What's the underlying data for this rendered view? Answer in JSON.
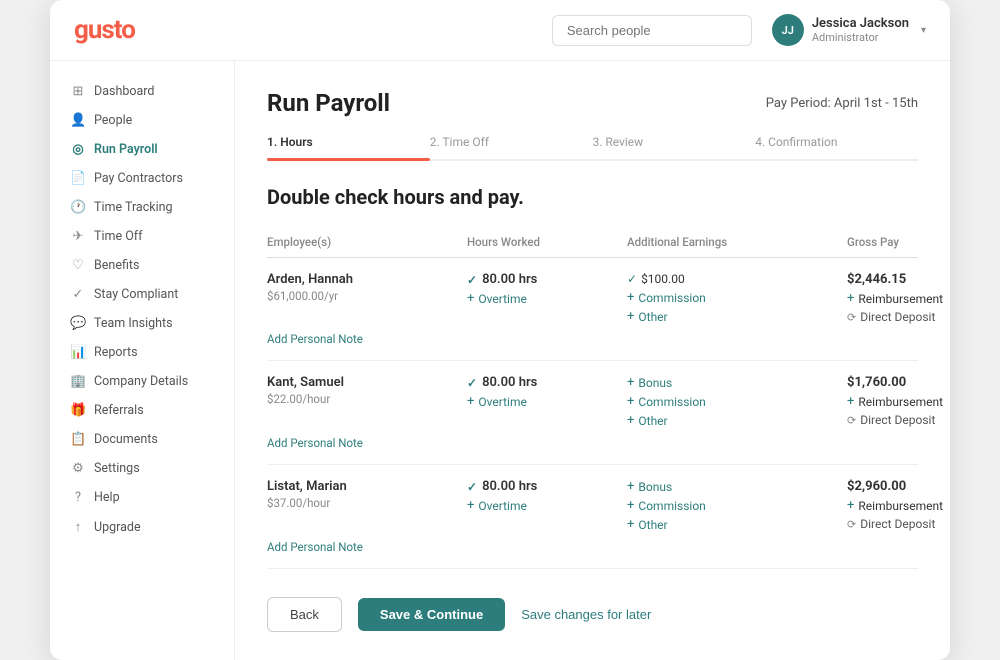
{
  "logo": "gusto",
  "search": {
    "placeholder": "Search people"
  },
  "user": {
    "name": "Jessica Jackson",
    "role": "Administrator",
    "initials": "JJ"
  },
  "sidebar": {
    "items": [
      {
        "id": "dashboard",
        "label": "Dashboard",
        "icon": "⊞",
        "active": false
      },
      {
        "id": "people",
        "label": "People",
        "icon": "👤",
        "active": false
      },
      {
        "id": "run-payroll",
        "label": "Run Payroll",
        "icon": "◎",
        "active": true
      },
      {
        "id": "pay-contractors",
        "label": "Pay Contractors",
        "icon": "📄",
        "active": false
      },
      {
        "id": "time-tracking",
        "label": "Time Tracking",
        "icon": "🕐",
        "active": false
      },
      {
        "id": "time-off",
        "label": "Time Off",
        "icon": "✈",
        "active": false
      },
      {
        "id": "benefits",
        "label": "Benefits",
        "icon": "♡",
        "active": false
      },
      {
        "id": "stay-compliant",
        "label": "Stay Compliant",
        "icon": "✓",
        "active": false
      },
      {
        "id": "team-insights",
        "label": "Team Insights",
        "icon": "💬",
        "active": false
      },
      {
        "id": "reports",
        "label": "Reports",
        "icon": "📊",
        "active": false
      },
      {
        "id": "company-details",
        "label": "Company Details",
        "icon": "🏢",
        "active": false
      },
      {
        "id": "referrals",
        "label": "Referrals",
        "icon": "🎁",
        "active": false
      },
      {
        "id": "documents",
        "label": "Documents",
        "icon": "📋",
        "active": false
      },
      {
        "id": "settings",
        "label": "Settings",
        "icon": "⚙",
        "active": false
      },
      {
        "id": "help",
        "label": "Help",
        "icon": "?",
        "active": false
      },
      {
        "id": "upgrade",
        "label": "Upgrade",
        "icon": "↑",
        "active": false
      }
    ]
  },
  "page": {
    "title": "Run Payroll",
    "pay_period": "Pay Period: April 1st - 15th",
    "steps": [
      {
        "label": "1. Hours",
        "active": true
      },
      {
        "label": "2. Time Off",
        "active": false
      },
      {
        "label": "3. Review",
        "active": false
      },
      {
        "label": "4. Confirmation",
        "active": false
      }
    ],
    "section_heading": "Double check hours and pay.",
    "table_headers": {
      "employee": "Employee(s)",
      "hours": "Hours Worked",
      "earnings": "Additional Earnings",
      "gross": "Gross Pay"
    },
    "employees": [
      {
        "name": "Arden, Hannah",
        "rate": "$61,000.00/yr",
        "hours": "80.00 hrs",
        "overtime_label": "Overtime",
        "earnings": [
          {
            "type": "value",
            "label": "$100.00"
          },
          {
            "type": "add",
            "label": "Commission"
          },
          {
            "type": "add",
            "label": "Other"
          }
        ],
        "gross": "$2,446.15",
        "gross_actions": [
          {
            "type": "add",
            "label": "Reimbursement"
          },
          {
            "type": "dd",
            "label": "Direct Deposit"
          }
        ],
        "note_label": "Add Personal Note"
      },
      {
        "name": "Kant, Samuel",
        "rate": "$22.00/hour",
        "hours": "80.00 hrs",
        "overtime_label": "Overtime",
        "earnings": [
          {
            "type": "add",
            "label": "Bonus"
          },
          {
            "type": "add",
            "label": "Commission"
          },
          {
            "type": "add",
            "label": "Other"
          }
        ],
        "gross": "$1,760.00",
        "gross_actions": [
          {
            "type": "add",
            "label": "Reimbursement"
          },
          {
            "type": "dd",
            "label": "Direct Deposit"
          }
        ],
        "note_label": "Add Personal Note"
      },
      {
        "name": "Listat, Marian",
        "rate": "$37.00/hour",
        "hours": "80.00 hrs",
        "overtime_label": "Overtime",
        "earnings": [
          {
            "type": "add",
            "label": "Bonus"
          },
          {
            "type": "add",
            "label": "Commission"
          },
          {
            "type": "add",
            "label": "Other"
          }
        ],
        "gross": "$2,960.00",
        "gross_actions": [
          {
            "type": "add",
            "label": "Reimbursement"
          },
          {
            "type": "dd",
            "label": "Direct Deposit"
          }
        ],
        "note_label": "Add Personal Note"
      }
    ],
    "buttons": {
      "back": "Back",
      "continue": "Save & Continue",
      "save_later": "Save changes for later"
    }
  }
}
